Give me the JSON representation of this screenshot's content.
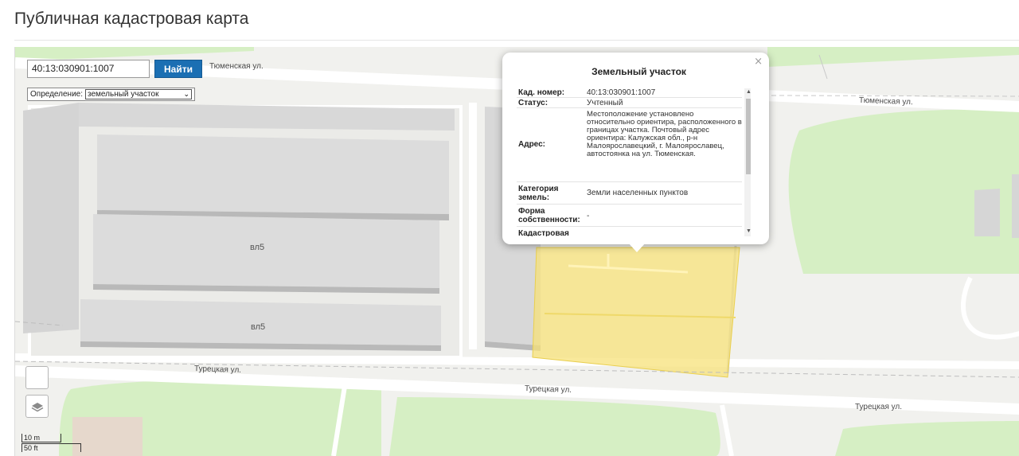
{
  "page": {
    "title": "Публичная кадастровая карта"
  },
  "search": {
    "value": "40:13:030901:1007",
    "button_label": "Найти"
  },
  "definition": {
    "label": "Определение:",
    "value": "земельный участок"
  },
  "map": {
    "streets": [
      "Тюменская ул.",
      "Тюменская ул.",
      "Турецкая ул.",
      "Турецкая ул.",
      "Турецкая ул."
    ],
    "buildings": [
      "вл5",
      "вл5"
    ],
    "scale": {
      "metric": "10 m",
      "imperial": "50 ft"
    },
    "colors": {
      "parcel": "#f7e27a",
      "green": "#d6efc4",
      "building": "#dcdcdc",
      "button": "#1b6fb3"
    }
  },
  "popup": {
    "title": "Земельный участок",
    "close": "×",
    "rows": [
      {
        "key": "Кад. номер:",
        "value": "40:13:030901:1007"
      },
      {
        "key": "Статус:",
        "value": "Учтенный"
      },
      {
        "key": "Адрес:",
        "value": "Местоположение установлено относительно ориентира, расположенного в границах участка. Почтовый адрес ориентира: Калужская обл., р-н Малоярославецкий, г. Малоярославец, автостоянка на ул. Тюменская."
      },
      {
        "key": "Категория земель:",
        "value": "Земли населенных пунктов"
      },
      {
        "key": "Форма собственности:",
        "value": "-"
      },
      {
        "key": "Кадастровая",
        "value": ""
      }
    ]
  }
}
